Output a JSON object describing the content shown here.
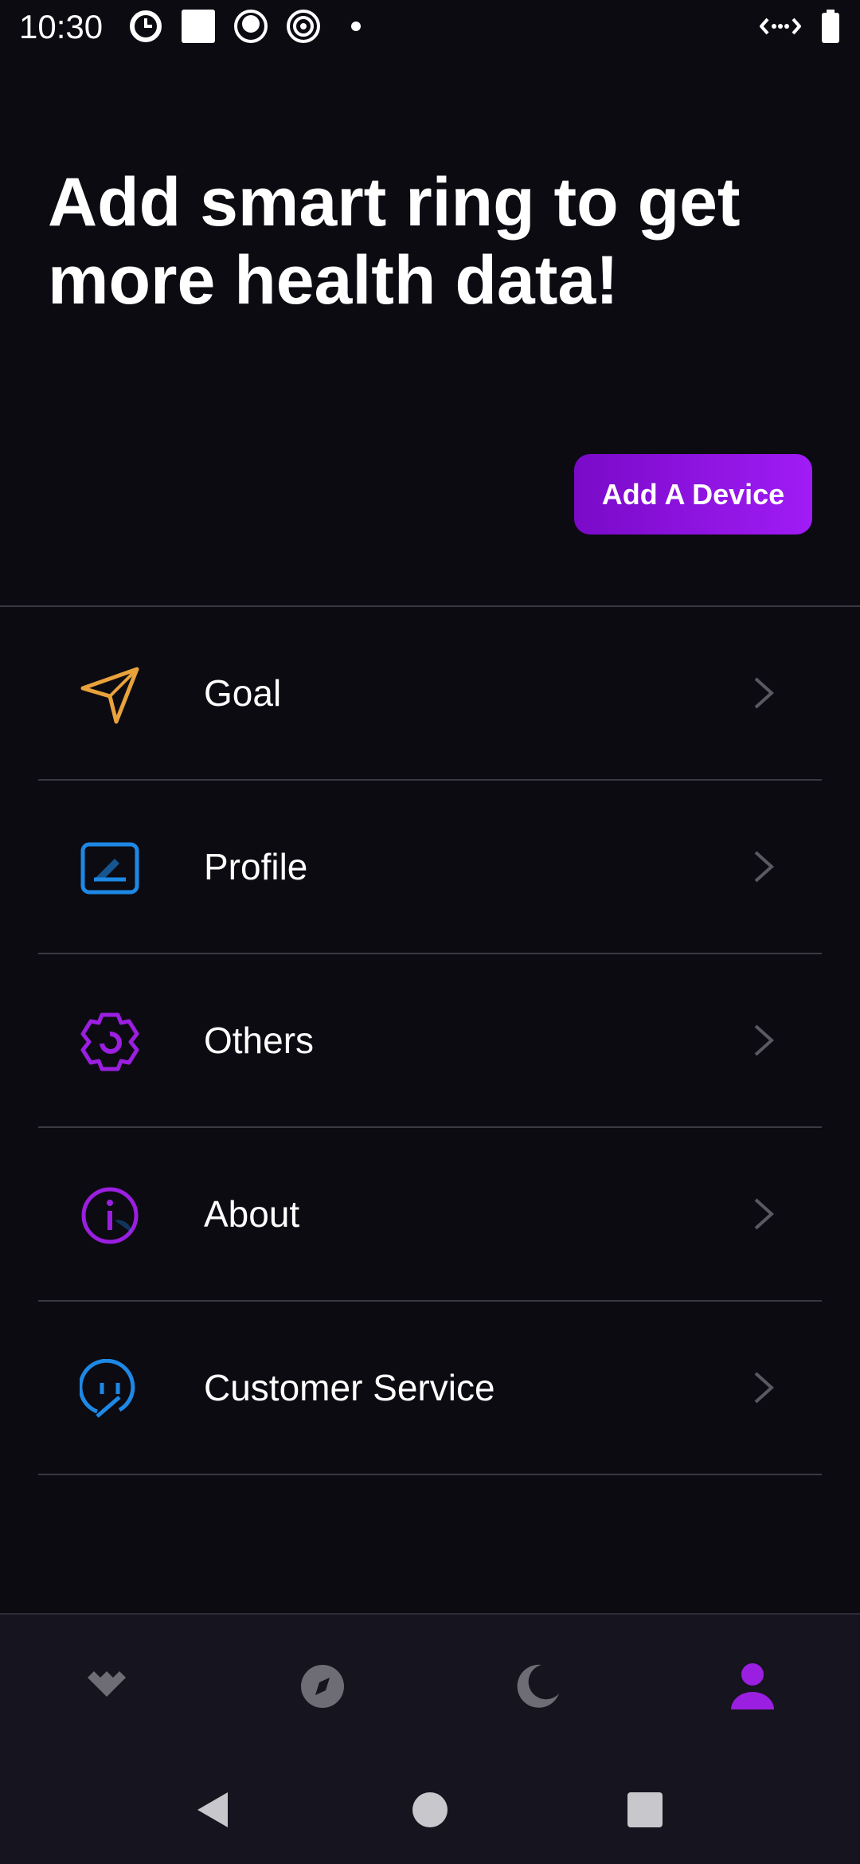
{
  "status_bar": {
    "time": "10:30"
  },
  "hero": {
    "title": "Add smart ring to get more health data!",
    "add_device_label": "Add A Device"
  },
  "menu": [
    {
      "label": "Goal",
      "icon": "paper-plane-icon",
      "color": "#e9a23b"
    },
    {
      "label": "Profile",
      "icon": "profile-edit-icon",
      "color": "#1e88e5"
    },
    {
      "label": "Others",
      "icon": "gear-icon",
      "color": "#9b1fe0"
    },
    {
      "label": "About",
      "icon": "info-icon",
      "color": "#9b1fe0"
    },
    {
      "label": "Customer Service",
      "icon": "chat-support-icon",
      "color": "#1e88e5"
    }
  ],
  "bottom_nav": {
    "active_color": "#9b1fe0",
    "inactive_color": "#6e6d75",
    "items": [
      "dashboard-icon",
      "explore-icon",
      "sleep-icon",
      "profile-icon"
    ]
  },
  "colors": {
    "background": "#0c0b12",
    "accent": "#9b1fe0"
  }
}
